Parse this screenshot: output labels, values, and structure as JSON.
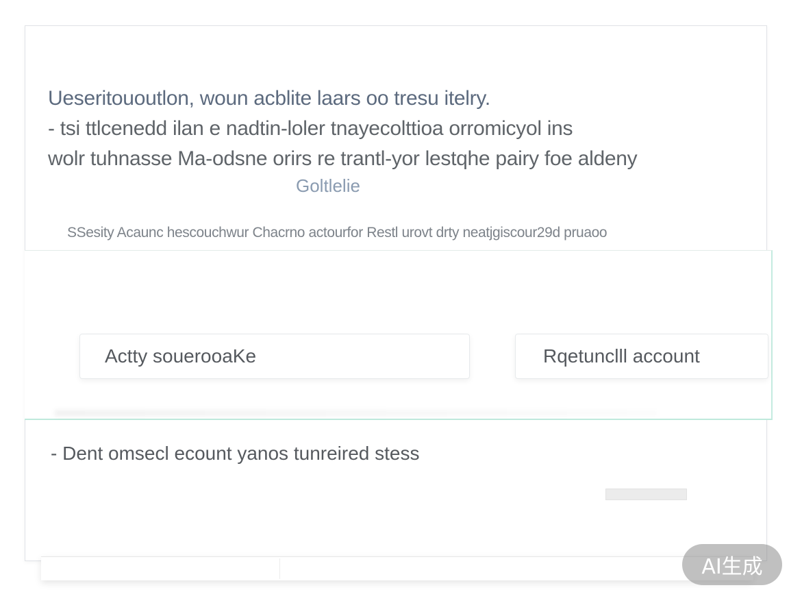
{
  "headline": {
    "line1": "Ueseritououtlon, woun acblite laars oo tresu itelry.",
    "line2": "- tsi ttlcenedd ilan e nadtin-loler tnayecolttioa orromicyol ins",
    "line3": "wolr tuhnasse Ma-odsne orirs re trantl-yor lestqhe pairy foe aldeny",
    "link": "Goltlelie"
  },
  "subtitle": "SSesity Acaunc hescouchwur Chacrno actourfor Restl urovt drty neatjgiscour29d pruaoo",
  "buttons": {
    "left_label": "Actty souerooaKe",
    "right_label": "Rqetunclll account"
  },
  "footnote": "- Dent omsecl ecount yanos tunreired stess",
  "watermark": "AI生成"
}
